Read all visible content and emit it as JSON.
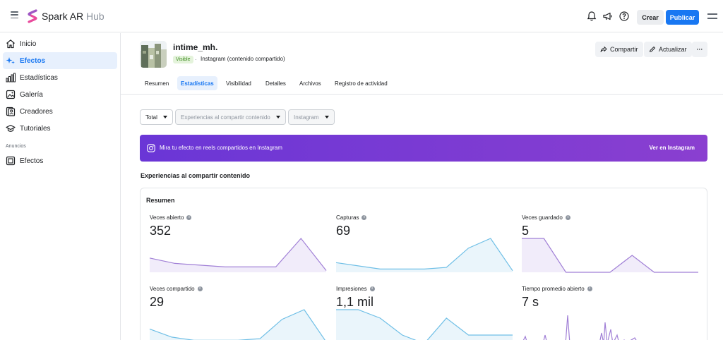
{
  "app": {
    "name": "Spark AR",
    "name_suffix": "Hub"
  },
  "topbar": {
    "crear_label": "Crear",
    "publicar_label": "Publicar",
    "icons": [
      "bell-icon",
      "megaphone-icon",
      "help-icon",
      "menu-icon"
    ]
  },
  "sidebar": {
    "items": [
      {
        "label": "Inicio",
        "icon": "home-icon",
        "active": false
      },
      {
        "label": "Efectos",
        "icon": "sparkle-icon",
        "active": true
      },
      {
        "label": "Estadísticas",
        "icon": "bar-chart-icon",
        "active": false
      },
      {
        "label": "Galería",
        "icon": "gallery-icon",
        "active": false
      },
      {
        "label": "Creadores",
        "icon": "creators-icon",
        "active": false
      },
      {
        "label": "Tutoriales",
        "icon": "graduation-cap-icon",
        "active": false
      }
    ],
    "section_label": "Anuncios",
    "section_items": [
      {
        "label": "Efectos",
        "icon": "ad-frame-icon"
      }
    ]
  },
  "effect": {
    "name": "intime_mh.",
    "status_badge": "Visible",
    "platform": "Instagram (contenido compartido)",
    "actions": {
      "share_label": "Compartir",
      "update_label": "Actualizar",
      "more_label": "···"
    }
  },
  "tabs": [
    {
      "label": "Resumen",
      "active": false
    },
    {
      "label": "Estadísticas",
      "active": true
    },
    {
      "label": "Visibilidad",
      "active": false
    },
    {
      "label": "Detalles",
      "active": false
    },
    {
      "label": "Archivos",
      "active": false
    },
    {
      "label": "Registro de actividad",
      "active": false
    }
  ],
  "filters": [
    {
      "label": "Total",
      "disabled": false
    },
    {
      "label": "Experiencias al compartir contenido",
      "disabled": true
    },
    {
      "label": "Instagram",
      "disabled": true
    }
  ],
  "banner": {
    "text": "Mira tu efecto en reels compartidos en Instagram",
    "link_label": "Ver en Instagram"
  },
  "section_title": "Experiencias al compartir contenido",
  "summary": {
    "title": "Resumen",
    "metrics": [
      {
        "label": "Veces abierto",
        "value": "352",
        "color": "#a07fd6",
        "fill": "#f1ecfa",
        "trend": [
          8,
          5,
          4,
          3,
          3,
          3,
          19,
          1
        ]
      },
      {
        "label": "Capturas",
        "value": "69",
        "color": "#6fbfe6",
        "fill": "#eaf5fb",
        "trend": [
          6,
          4,
          2,
          2,
          2,
          3,
          15,
          21,
          1
        ]
      },
      {
        "label": "Veces guardado",
        "value": "5",
        "color": "#a07fd6",
        "fill": "#f1ecfa",
        "trend": [
          2,
          2,
          0,
          0,
          0,
          1,
          0,
          0,
          0
        ]
      },
      {
        "label": "Veces compartido",
        "value": "29",
        "color": "#6fbfe6",
        "fill": "#eaf5fb",
        "trend": [
          9,
          4,
          2,
          2,
          2,
          3,
          15,
          21,
          1
        ]
      },
      {
        "label": "Impresiones",
        "value": "1,1 mil",
        "color": "#6fbfe6",
        "fill": "#eaf5fb",
        "trend": [
          4,
          4,
          3,
          1,
          0,
          3,
          1,
          1,
          1
        ]
      },
      {
        "label": "Tiempo promedio abierto",
        "value": "7 s",
        "color": "#a07fd6",
        "fill": "#f1ecfa",
        "trend": []
      }
    ]
  }
}
